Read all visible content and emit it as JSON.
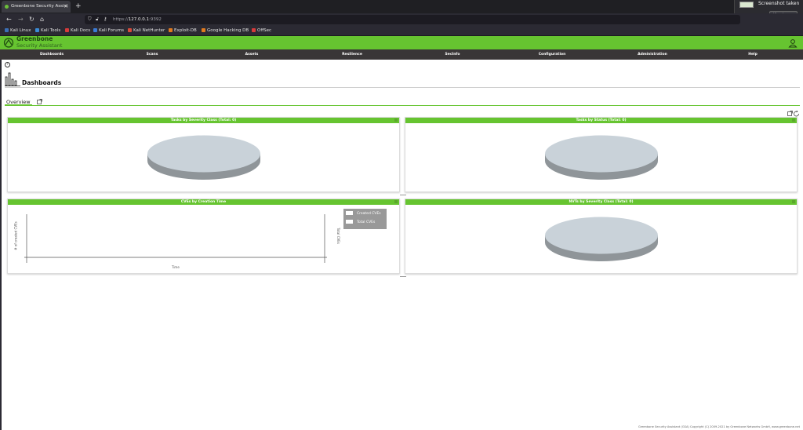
{
  "browser": {
    "tab_title": "Greenbone Security Assist",
    "new_tab": "+",
    "url_prefix": "https://",
    "url_host": "127.0.0.1",
    "url_port": ":9392",
    "toast_title": "Screenshot taken",
    "toast_button": "View image",
    "bookmarks": [
      "Kali Linux",
      "Kali Tools",
      "Kali Docs",
      "Kali Forums",
      "Kali NetHunter",
      "Exploit-DB",
      "Google Hacking DB",
      "OffSec"
    ]
  },
  "app": {
    "logo_line1": "Greenbone",
    "logo_line2": "Security Assistant",
    "menu": [
      "Dashboards",
      "Scans",
      "Assets",
      "Resilience",
      "SecInfo",
      "Configuration",
      "Administration",
      "Help"
    ]
  },
  "page": {
    "help": "?",
    "title": "Dashboards",
    "tab_overview": "Overview"
  },
  "panels": {
    "p1_title": "Tasks by Severity Class (Total: 0)",
    "p2_title": "Tasks by Status (Total: 0)",
    "p3_title": "CVEs by Creation Time",
    "p4_title": "NVTs by Severity Class (Total: 0)",
    "p3_ylabel": "# of created CVEs",
    "p3_xlabel": "Time",
    "p3_y2label": "Total CVEs",
    "p3_legend": [
      "Created CVEs",
      "Total CVEs"
    ]
  },
  "footer": "Greenbone Security Assistant (GSA) Copyright (C) 2009-2021 by Greenbone Networks GmbH, www.greenbone.net",
  "colors": {
    "brand_green": "#66c430",
    "menu_bg": "#393637",
    "pie_top": "#c9d2d9",
    "pie_side": "#8f9599"
  }
}
